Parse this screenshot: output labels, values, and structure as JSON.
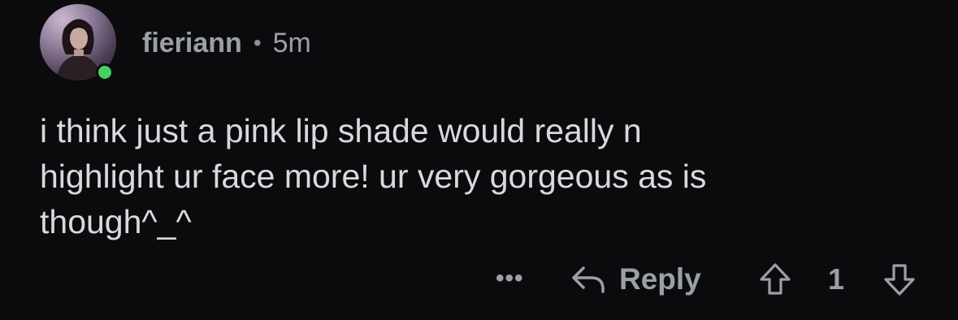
{
  "comment": {
    "username": "fieriann",
    "separator": "•",
    "time": "5m",
    "online_status_color": "#46d160",
    "text": "i think just a pink lip shade would really n\nhighlight ur face more! ur very gorgeous as is\nthough^_^"
  },
  "actions": {
    "more_label": "•••",
    "reply_label": "Reply",
    "reply_icon": "reply-arrow-icon",
    "upvote_icon": "upvote-arrow-icon",
    "score": "1",
    "downvote_icon": "downvote-arrow-icon"
  }
}
